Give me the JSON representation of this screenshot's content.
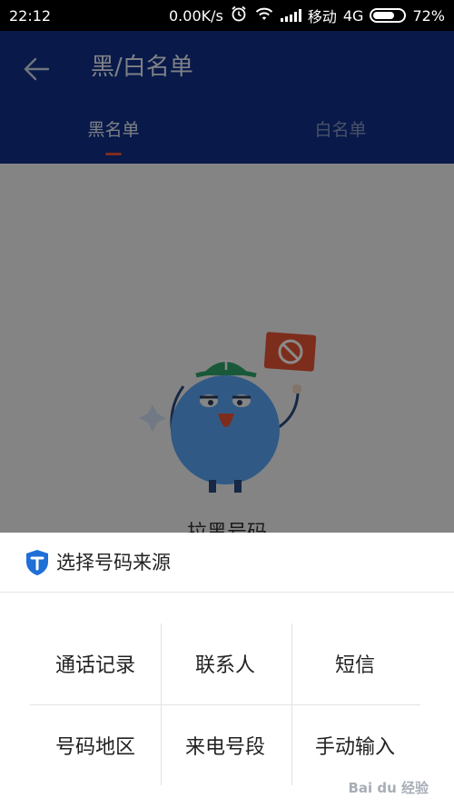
{
  "status_bar": {
    "time": "22:12",
    "speed": "0.00K/s",
    "carrier": "移动",
    "network": "4G",
    "battery": "72%",
    "battery_level": 0.72
  },
  "app_bar": {
    "title": "黑/白名单",
    "tabs": [
      {
        "label": "黑名单",
        "active": true
      },
      {
        "label": "白名单",
        "active": false
      }
    ]
  },
  "content": {
    "empty_text": "拉黑号码"
  },
  "sheet": {
    "title": "选择号码来源",
    "options": [
      "通话记录",
      "联系人",
      "短信",
      "号码地区",
      "来电号段",
      "手动输入"
    ]
  },
  "watermark": "Bai du 经验",
  "colors": {
    "app_bar": "#0f2f8a",
    "tab_indicator": "#e85434",
    "shield": "#1f6fd6"
  }
}
